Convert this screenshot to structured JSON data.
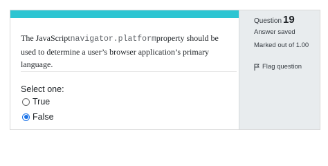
{
  "question": {
    "text_before": "The JavaScript",
    "code": "navigator.platform",
    "text_after": "property should be used to determine a user’s browser application’s primary language."
  },
  "answer": {
    "prompt": "Select one:",
    "options": [
      {
        "label": "True",
        "selected": false
      },
      {
        "label": "False",
        "selected": true
      }
    ]
  },
  "info": {
    "question_label": "Question",
    "question_number": "19",
    "state": "Answer saved",
    "grade": "Marked out of 1.00",
    "flag_label": "Flag question",
    "flag_icon": "flag-icon"
  },
  "colors": {
    "accent_bar": "#2cc5d2",
    "selected_radio": "#1a73e8",
    "info_panel": "#e8ecee"
  }
}
